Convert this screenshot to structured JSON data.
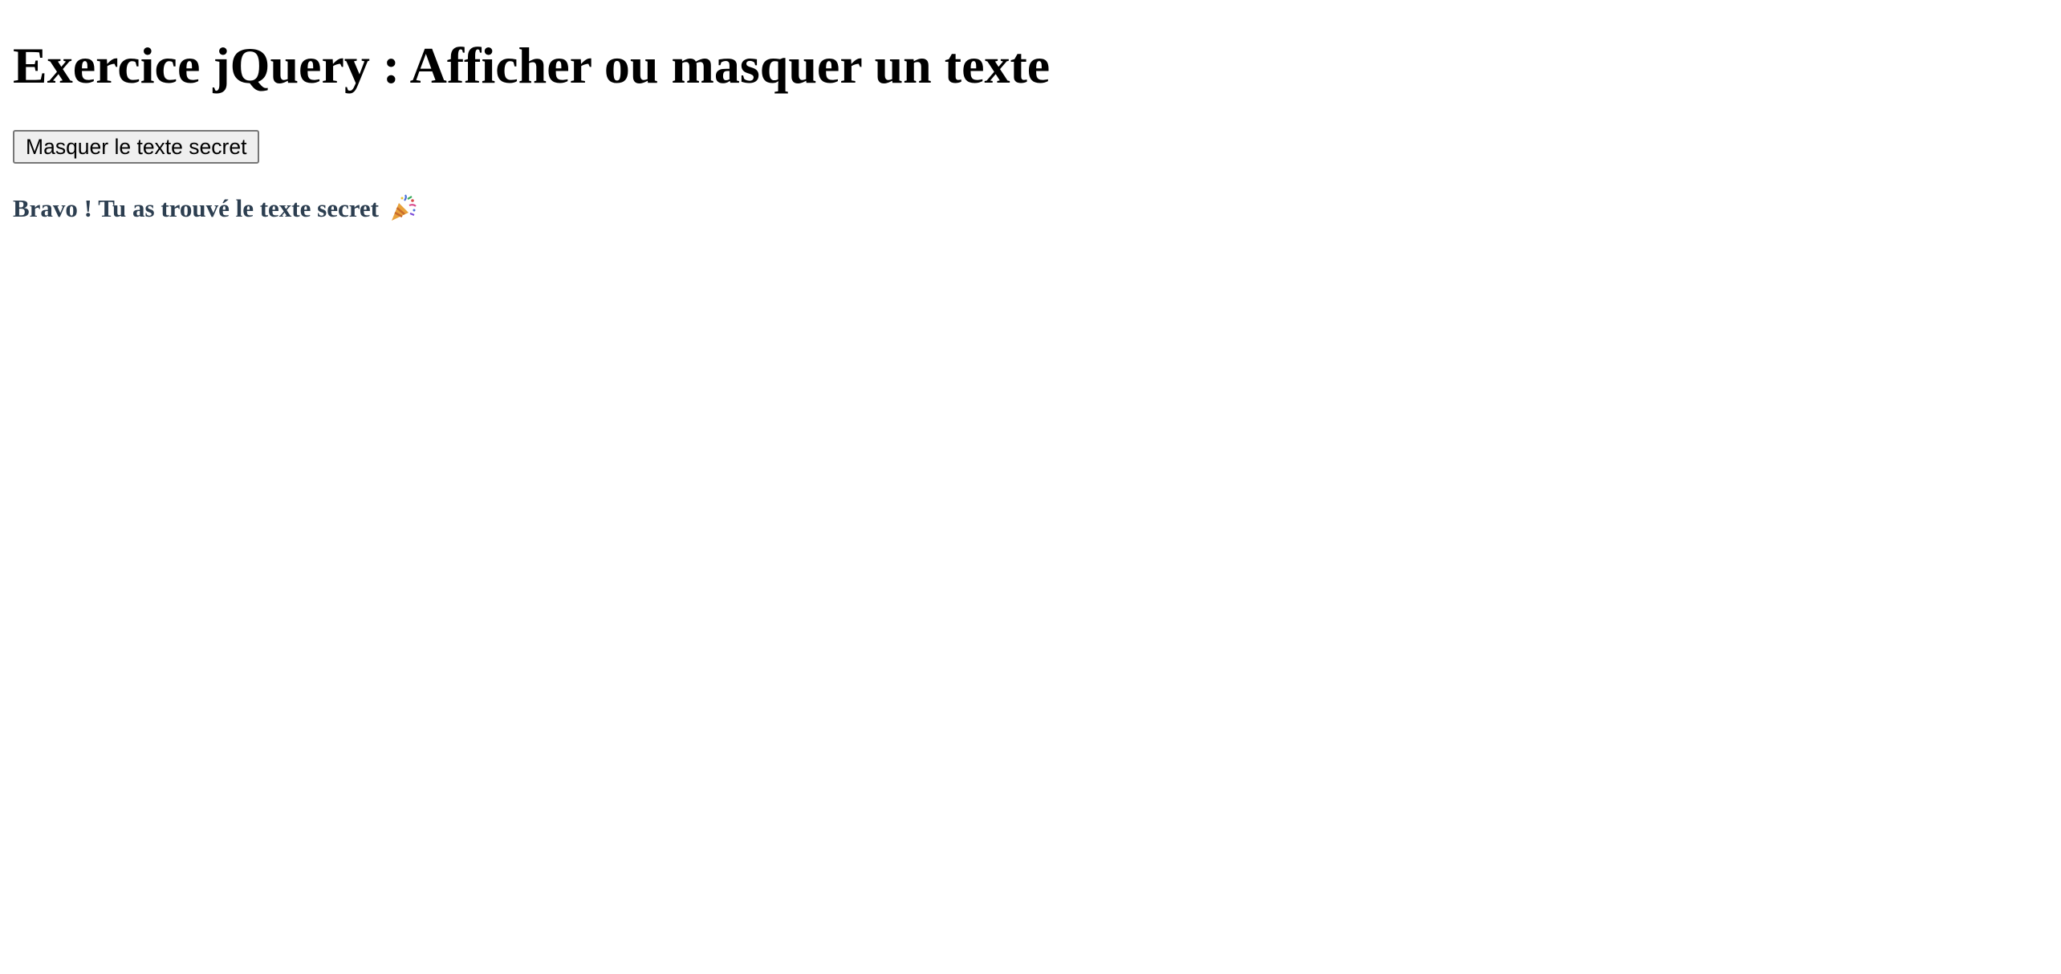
{
  "page": {
    "title": "Exercice jQuery : Afficher ou masquer un texte"
  },
  "toggle_button": {
    "label": "Masquer le texte secret"
  },
  "secret": {
    "text": "Bravo ! Tu as trouvé le texte secret",
    "icon": "party-popper-icon",
    "color": "#2c3e50"
  }
}
